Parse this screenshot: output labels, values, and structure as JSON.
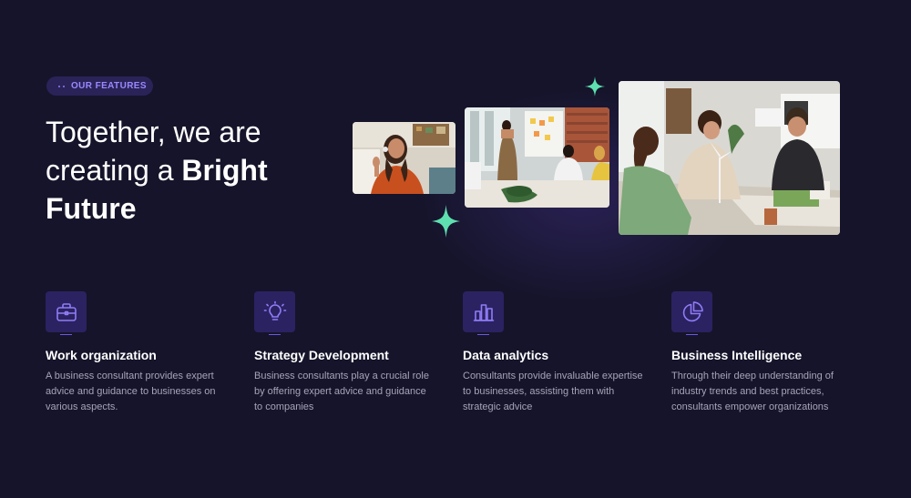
{
  "section": {
    "badge_label": "OUR FEATURES",
    "title_line1": "Together, we are",
    "title_line2_prefix": "creating a ",
    "title_bold": "Bright Future"
  },
  "photos": [
    {
      "name": "woman-on-video-call"
    },
    {
      "name": "team-presentation-meeting"
    },
    {
      "name": "consultants-discussing-wind-turbine-model"
    }
  ],
  "features": [
    {
      "icon": "briefcase-icon",
      "title": "Work organization",
      "description": "A business consultant provides expert advice and guidance to businesses on various aspects."
    },
    {
      "icon": "lightbulb-icon",
      "title": "Strategy Development",
      "description": "Business consultants play a crucial role by offering expert advice and guidance to companies"
    },
    {
      "icon": "bar-chart-icon",
      "title": "Data analytics",
      "description": "Consultants provide invaluable expertise to businesses, assisting them with strategic advice"
    },
    {
      "icon": "pie-chart-icon",
      "title": "Business Intelligence",
      "description": "Through their deep understanding of industry trends and best practices, consultants empower organizations"
    }
  ],
  "colors": {
    "background": "#15142a",
    "accent": "#8f7cf5",
    "icon_box": "#2b2262",
    "sparkle": "#5ee0b0"
  }
}
